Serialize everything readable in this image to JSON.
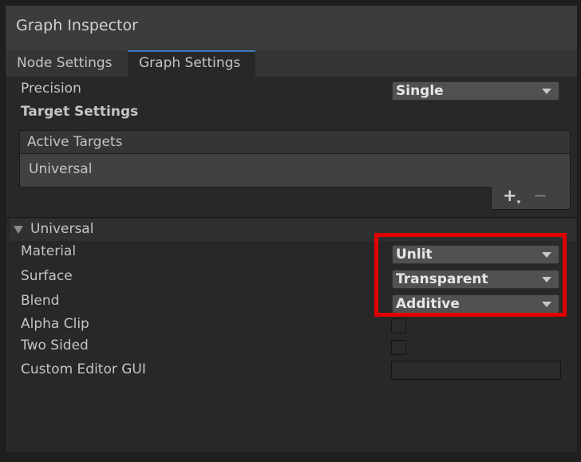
{
  "window": {
    "title": "Graph Inspector"
  },
  "tabs": [
    {
      "label": "Node Settings",
      "active": false
    },
    {
      "label": "Graph Settings",
      "active": true
    }
  ],
  "graph_settings": {
    "precision": {
      "label": "Precision",
      "value": "Single"
    },
    "target_settings_label": "Target Settings",
    "active_targets": {
      "header": "Active Targets",
      "items": [
        "Universal"
      ],
      "add_label": "+",
      "remove_label": "−"
    },
    "universal": {
      "label": "Universal",
      "material": {
        "label": "Material",
        "value": "Unlit"
      },
      "surface": {
        "label": "Surface",
        "value": "Transparent"
      },
      "blend": {
        "label": "Blend",
        "value": "Additive"
      },
      "alpha_clip": {
        "label": "Alpha Clip",
        "checked": false
      },
      "two_sided": {
        "label": "Two Sided",
        "checked": false
      },
      "custom_editor_gui": {
        "label": "Custom Editor GUI",
        "value": ""
      }
    }
  },
  "colors": {
    "accent_tab": "#3a79bb",
    "highlight": "#e00000"
  }
}
